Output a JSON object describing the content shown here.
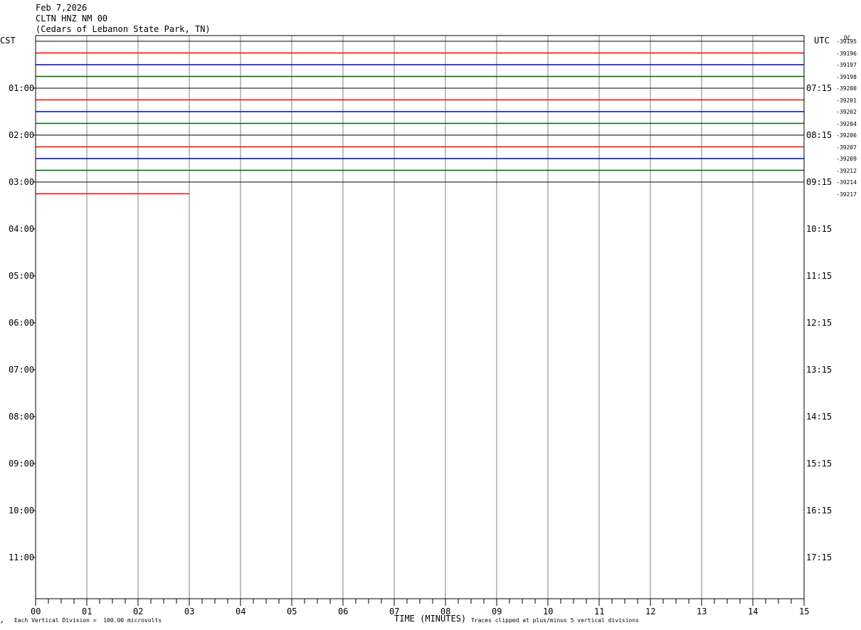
{
  "header": {
    "date": "Feb 7,2026",
    "station": "CLTN HNZ NM 00",
    "location": "(Cedars of Lebanon State Park, TN)"
  },
  "left_axis_label": "CST",
  "right_axis_label": "UTC",
  "dc_label": "DC",
  "footer": {
    "scale_note": "Each Vertical Division =  100.00 microvolts",
    "xlabel": "TIME (MINUTES)",
    "clip_note": "Traces clipped at plus/minus 5 vertical divisions",
    "corner_mark": "↗"
  },
  "colors": {
    "red": "#ff0000",
    "blue": "#0000cc",
    "green": "#006400",
    "black": "#000000",
    "grid": "#808080"
  },
  "chart_data": {
    "type": "line",
    "x_ticks": [
      "00",
      "01",
      "02",
      "03",
      "04",
      "05",
      "06",
      "07",
      "08",
      "09",
      "10",
      "11",
      "12",
      "13",
      "14",
      "15"
    ],
    "xlim": [
      0,
      15
    ],
    "left_hour_labels": [
      "01:00",
      "02:00",
      "03:00",
      "04:00",
      "05:00",
      "06:00",
      "07:00",
      "08:00",
      "09:00",
      "10:00",
      "11:00"
    ],
    "right_hour_labels": [
      "07:15",
      "08:15",
      "09:15",
      "10:15",
      "11:15",
      "12:15",
      "13:15",
      "14:15",
      "15:15",
      "16:15",
      "17:15"
    ],
    "dc_offsets": [
      "-39195",
      "-39196",
      "-39197",
      "-39198",
      "-39200",
      "-39201",
      "-39202",
      "-39204",
      "-39206",
      "-39207",
      "-39209",
      "-39212",
      "-39214",
      "-39217"
    ],
    "trace_colors": [
      "black",
      "red",
      "blue",
      "green",
      "black",
      "red",
      "blue",
      "green",
      "black",
      "red",
      "blue",
      "green",
      "black",
      "red"
    ],
    "trace_end_minutes": [
      15,
      15,
      15,
      15,
      15,
      15,
      15,
      15,
      15,
      15,
      15,
      15,
      15,
      3
    ]
  }
}
